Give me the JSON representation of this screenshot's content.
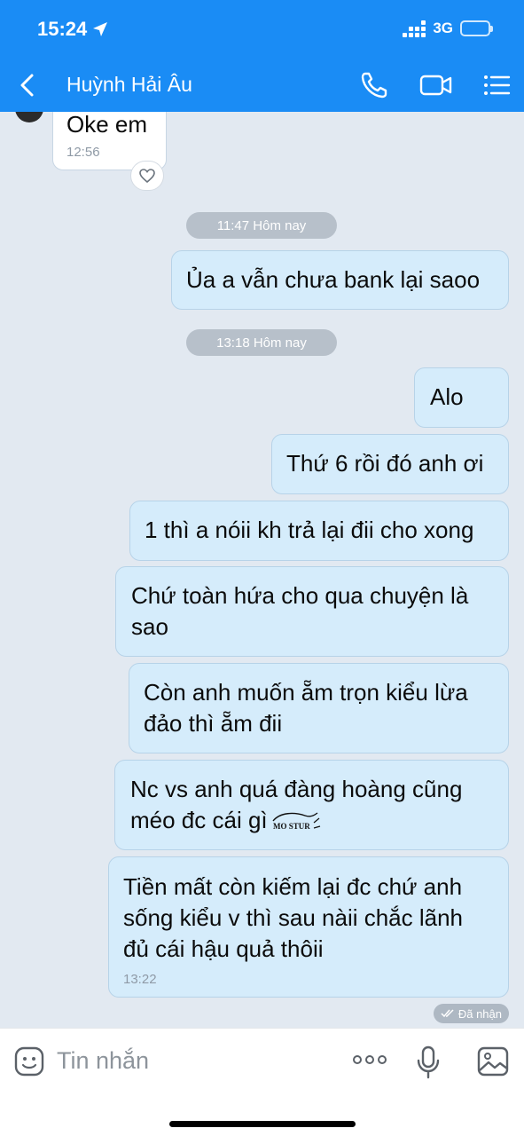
{
  "status_bar": {
    "time": "15:24",
    "network": "3G"
  },
  "header": {
    "contact_name": "Huỳnh Hải Âu"
  },
  "messages": [
    {
      "text": "Oke em",
      "time": "12:56"
    },
    {
      "text": "Ủa a vẫn chưa bank lại saoo"
    },
    {
      "text": "Alo"
    },
    {
      "text": "Thứ 6 rồi đó anh ơi"
    },
    {
      "text": "1 thì a nóii kh trả lại đii cho xong"
    },
    {
      "line1": "Chứ toàn hứa cho qua chuyện là",
      "line2": "sao"
    },
    {
      "line1": "Còn anh muốn ẵm trọn kiểu lừa",
      "line2": "đảo thì ẵm đii"
    },
    {
      "line1": "Nc vs anh quá đàng hoàng cũng",
      "line2": "méo đc cái gì",
      "sticker_text": "MO STUR"
    },
    {
      "line1": "Tiền mất còn kiếm lại đc chứ anh",
      "line2": "sống kiểu v thì sau nàii chắc lãnh",
      "line3": "đủ cái hậu quả thôii",
      "time": "13:22"
    }
  ],
  "separators": {
    "s1": "11:47 Hôm nay",
    "s2": "13:18 Hôm nay"
  },
  "delivery_status": "Đã nhận",
  "composer": {
    "placeholder": "Tin nhắn"
  },
  "colors": {
    "header": "#1a8cf5",
    "chat_bg": "#e2e9f1",
    "outgoing_bubble": "#d5ecfb",
    "incoming_bubble": "#ffffff"
  },
  "icons": [
    "location-arrow-icon",
    "signal-icon",
    "battery-icon",
    "back-icon",
    "phone-icon",
    "video-icon",
    "list-menu-icon",
    "heart-icon",
    "double-check-icon",
    "emoji-icon",
    "more-icon",
    "mic-icon",
    "image-icon"
  ]
}
